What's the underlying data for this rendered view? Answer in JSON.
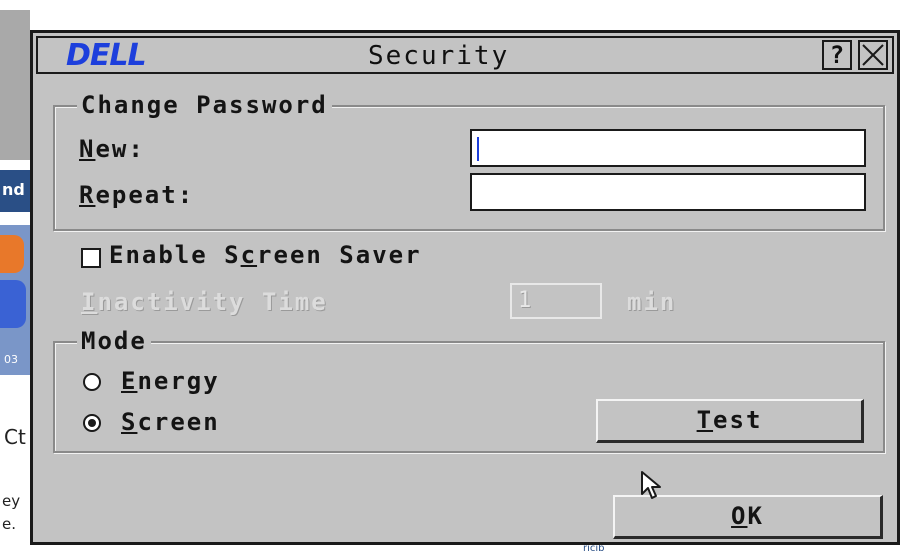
{
  "window": {
    "logo": "DELL",
    "title": "Security",
    "help_label": "?"
  },
  "change_password": {
    "group_title": "Change Password",
    "new_label_u": "N",
    "new_label_rest": "ew:",
    "new_value": "",
    "repeat_label_u": "R",
    "repeat_label_rest": "epeat:",
    "repeat_value": ""
  },
  "screen_saver": {
    "enable_pre": "Enable S",
    "enable_u": "c",
    "enable_post": "reen Saver",
    "enabled": false,
    "inactivity_u": "I",
    "inactivity_rest": "nactivity Time",
    "inactivity_value": "1",
    "inactivity_unit": "min"
  },
  "mode": {
    "group_title": "Mode",
    "energy_u": "E",
    "energy_rest": "nergy",
    "screen_u": "S",
    "screen_rest": "creen",
    "selected": "Screen",
    "test_u": "T",
    "test_rest": "est"
  },
  "ok": {
    "u": "O",
    "rest": "K"
  },
  "background": {
    "blue_bar_text": "nd",
    "img_text": "03",
    "ct_text": "Ct",
    "ey_text": "ey",
    "e_text": "e.",
    "bottom_text": "ricib"
  },
  "colors": {
    "dialog_bg": "#c3c3c3",
    "logo_blue": "#1d3fdc",
    "border": "#1a1a1a"
  }
}
